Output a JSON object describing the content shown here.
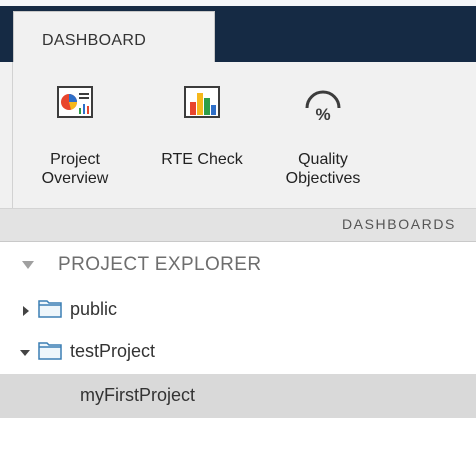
{
  "ribbon": {
    "tab_label": "DASHBOARD",
    "section_label": "DASHBOARDS",
    "buttons": [
      {
        "label": "Project\nOverview",
        "icon": "pie-chart-report-icon"
      },
      {
        "label": "RTE Check",
        "icon": "bar-chart-icon"
      },
      {
        "label": "Quality\nObjectives",
        "icon": "percent-gauge-icon"
      }
    ]
  },
  "explorer": {
    "title": "PROJECT EXPLORER",
    "items": [
      {
        "label": "public",
        "expanded": false,
        "icon": "folder-icon"
      },
      {
        "label": "testProject",
        "expanded": true,
        "icon": "folder-icon"
      },
      {
        "label": "myFirstProject",
        "selected": true
      }
    ]
  },
  "colors": {
    "tabbar_dark": "#152a44",
    "toolstrip": "#f1f1f1",
    "selected_row": "#d9d9d9"
  }
}
